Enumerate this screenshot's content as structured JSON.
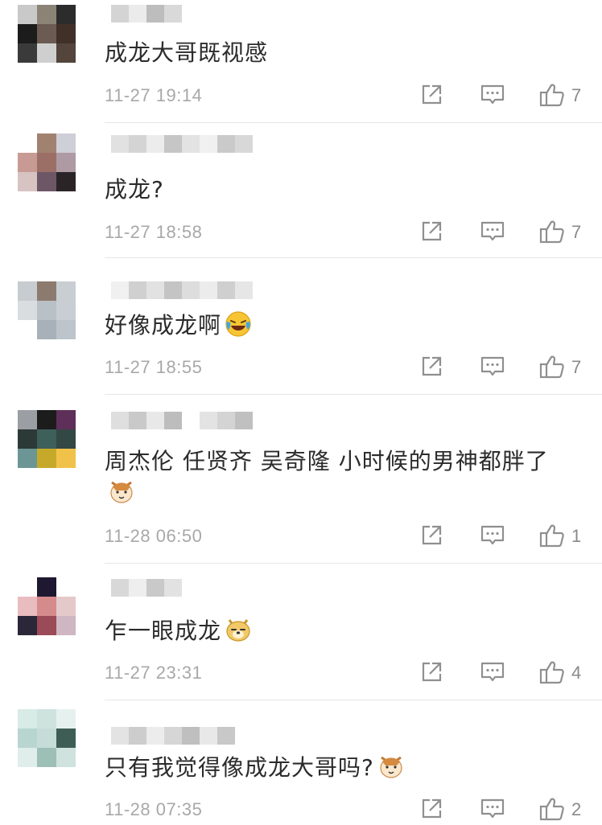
{
  "comments": [
    {
      "text": "成龙大哥既视感",
      "time": "11-27 19:14",
      "likes": "7",
      "emoji": "",
      "avatar": [
        "#c9c9c9",
        "#8b8375",
        "#2c2c2c",
        "#1c1c1c",
        "#6b5b52",
        "#403028",
        "#3a3a3a",
        "#cfcfcf",
        "#53443c"
      ],
      "name_blocks": [
        "#d4d4d4",
        "#ebebeb",
        "#bdbdbd",
        "#d9d9d9"
      ]
    },
    {
      "text": "成龙?",
      "time": "11-27 18:58",
      "likes": "7",
      "emoji": "",
      "avatar": [
        "#ffffff",
        "#a18271",
        "#cfcfd8",
        "#c79b93",
        "#9c6f66",
        "#ad9aa3",
        "#d8c3c3",
        "#6d5767",
        "#2a2427"
      ],
      "name_blocks": [
        "#e1e1e1",
        "#d4d4d4",
        "#ececec",
        "#c6c6c6",
        "#e3e3e3",
        "#f0f0f0",
        "#cacaca",
        "#d8d8d8"
      ]
    },
    {
      "text": "好像成龙啊",
      "time": "11-27 18:55",
      "likes": "7",
      "emoji": "laugh-cry",
      "avatar": [
        "#c7ccd0",
        "#8d7a6e",
        "#c9ced3",
        "#d9dde0",
        "#b9c0c6",
        "#c8ced4",
        "#ffffff",
        "#a8b1b9",
        "#bdc4cb"
      ],
      "name_blocks": [
        "#f0f0f0",
        "#d0d0d0",
        "#e2e2e2",
        "#c4c4c4",
        "#dddddd",
        "#ececec",
        "#cfcfcf",
        "#e6e6e6"
      ]
    },
    {
      "text": "周杰伦 任贤齐 吴奇隆 小时候的男神都胖了",
      "time": "11-28 06:50",
      "likes": "1",
      "emoji": "cat",
      "avatar": [
        "#9b9ea3",
        "#1c1c1c",
        "#5e2f59",
        "#2c3a37",
        "#3f5f5b",
        "#334744",
        "#6c9695",
        "#c7a92a",
        "#f1c24a"
      ],
      "name_blocks": [
        "#dedede",
        "#c9c9c9",
        "#e8e8e8",
        "#bdbdbd",
        "#ffffff",
        "#e3e3e3",
        "#d4d4d4",
        "#c0c0c0"
      ]
    },
    {
      "text": "乍一眼成龙",
      "time": "11-27 23:31",
      "likes": "4",
      "emoji": "doge",
      "avatar": [
        "#ffffff",
        "#1e1830",
        "#ffffff",
        "#e9bcc0",
        "#d58a8c",
        "#e4c9cb",
        "#2b2638",
        "#9b4a58",
        "#ceb7c2"
      ],
      "name_blocks": [
        "#d8d8d8",
        "#eeeeee",
        "#c9c9c9",
        "#e2e2e2"
      ]
    },
    {
      "text": "只有我觉得像成龙大哥吗?",
      "time": "11-28 07:35",
      "likes": "2",
      "emoji": "cat",
      "avatar": [
        "#d8ebe7",
        "#cfe3de",
        "#e6f1ef",
        "#b8d6cf",
        "#c6dcd7",
        "#3e5d55",
        "#dfeeea",
        "#9ebfb6",
        "#cfe2dd"
      ],
      "name_blocks": [
        "#e3e3e3",
        "#cdcdcd",
        "#ececec",
        "#d6d6d6",
        "#bfbfbf",
        "#e8e8e8",
        "#c8c8c8"
      ]
    }
  ],
  "colors": {
    "text": "#2b2b2b",
    "meta": "#a8a8a8",
    "icon": "#8f8f8f",
    "divider": "#e6e6e6"
  }
}
